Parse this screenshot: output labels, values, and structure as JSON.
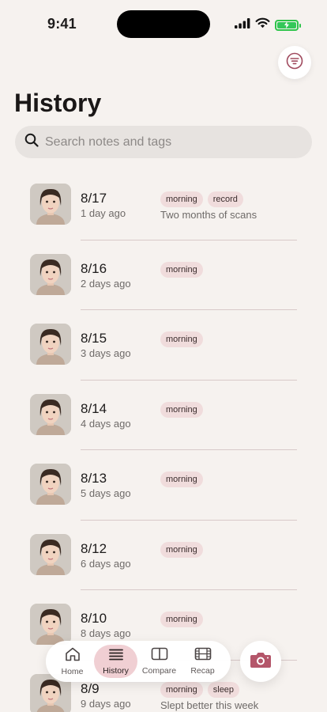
{
  "status_bar": {
    "time": "9:41"
  },
  "header": {
    "title": "History"
  },
  "search": {
    "placeholder": "Search notes and tags"
  },
  "entries": [
    {
      "date": "8/17",
      "ago": "1 day ago",
      "tags": [
        "morning",
        "record"
      ],
      "note": "Two months of scans"
    },
    {
      "date": "8/16",
      "ago": "2 days ago",
      "tags": [
        "morning"
      ],
      "note": ""
    },
    {
      "date": "8/15",
      "ago": "3 days ago",
      "tags": [
        "morning"
      ],
      "note": ""
    },
    {
      "date": "8/14",
      "ago": "4 days ago",
      "tags": [
        "morning"
      ],
      "note": ""
    },
    {
      "date": "8/13",
      "ago": "5 days ago",
      "tags": [
        "morning"
      ],
      "note": ""
    },
    {
      "date": "8/12",
      "ago": "6 days ago",
      "tags": [
        "morning"
      ],
      "note": ""
    },
    {
      "date": "8/10",
      "ago": "8 days ago",
      "tags": [
        "morning"
      ],
      "note": ""
    },
    {
      "date": "8/9",
      "ago": "9 days ago",
      "tags": [
        "morning",
        "sleep"
      ],
      "note": "Slept better this week"
    }
  ],
  "tab_bar": {
    "tabs": [
      {
        "label": "Home",
        "icon": "home-icon"
      },
      {
        "label": "History",
        "icon": "list-icon",
        "active": true
      },
      {
        "label": "Compare",
        "icon": "split-square-icon"
      },
      {
        "label": "Recap",
        "icon": "film-icon"
      }
    ],
    "camera_icon": "camera-icon"
  },
  "colors": {
    "background": "#f6f2ef",
    "accent": "#b4566a",
    "tag_bg": "#f0dcdc",
    "active_tab_bg": "#f0cfd3",
    "battery": "#34c759"
  }
}
